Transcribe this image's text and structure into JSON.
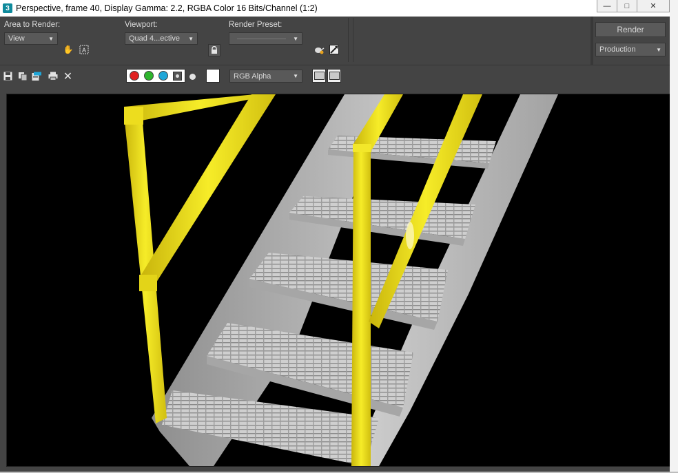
{
  "window": {
    "title": "Perspective, frame 40, Display Gamma: 2.2, RGBA Color 16 Bits/Channel (1:2)",
    "app_icon_glyph": "3",
    "controls": {
      "minimize": "—",
      "maximize": "□",
      "close": "✕"
    }
  },
  "render_panel": {
    "area_label": "Area to Render:",
    "area_value": "View",
    "viewport_label": "Viewport:",
    "viewport_value": "Quad 4...ective",
    "preset_label": "Render Preset:",
    "preset_value": "",
    "render_button": "Render",
    "mode_value": "Production"
  },
  "toolbar": {
    "channel_dropdown": "RGB Alpha",
    "channel_colors": {
      "red": "#e02020",
      "green": "#2db52d",
      "blue": "#1fa6d8"
    }
  },
  "icons": {
    "auto_region": "hand-icon",
    "crop": "crop-icon",
    "lock": "lock-icon",
    "env": "teapot-icon",
    "settings": "render-setup-icon",
    "save": "save-icon",
    "clone": "clone-icon",
    "copy": "copy-icon",
    "print": "print-icon",
    "clear": "close-icon"
  },
  "colors": {
    "panel": "#444444",
    "railing": "#f2e41a",
    "stairs": "#bcbcbc"
  }
}
